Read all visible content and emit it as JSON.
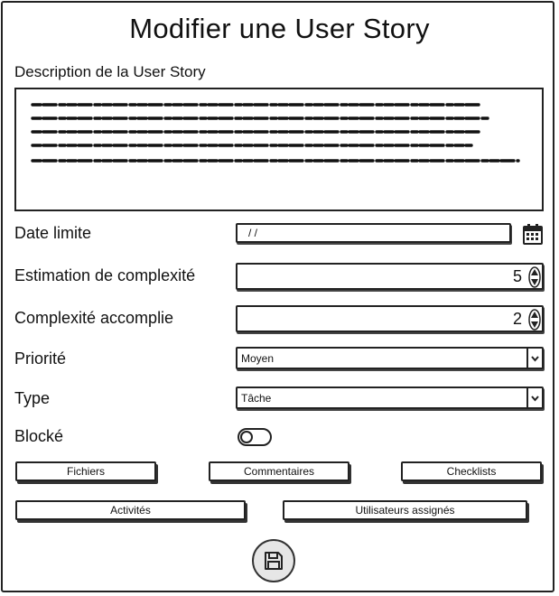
{
  "dialog": {
    "title": "Modifier une User Story"
  },
  "description": {
    "label": "Description de la User Story"
  },
  "fields": {
    "deadline": {
      "label": "Date limite",
      "value": "/ /"
    },
    "complexity_estimate": {
      "label": "Estimation de complexité",
      "value": "5"
    },
    "complexity_done": {
      "label": "Complexité accomplie",
      "value": "2"
    },
    "priority": {
      "label": "Priorité",
      "value": "Moyen"
    },
    "type": {
      "label": "Type",
      "value": "Tâche"
    },
    "blocked": {
      "label": "Blocké",
      "state": "off"
    }
  },
  "buttons": {
    "files": "Fichiers",
    "comments": "Commentaires",
    "checklists": "Checklists",
    "activities": "Activités",
    "assigned_users": "Utilisateurs assignés"
  },
  "icons": {
    "calendar": "calendar-icon",
    "save": "floppy-disk-icon",
    "spinner": "up-down-arrows-icon",
    "dropdown": "chevron-down-icon"
  }
}
